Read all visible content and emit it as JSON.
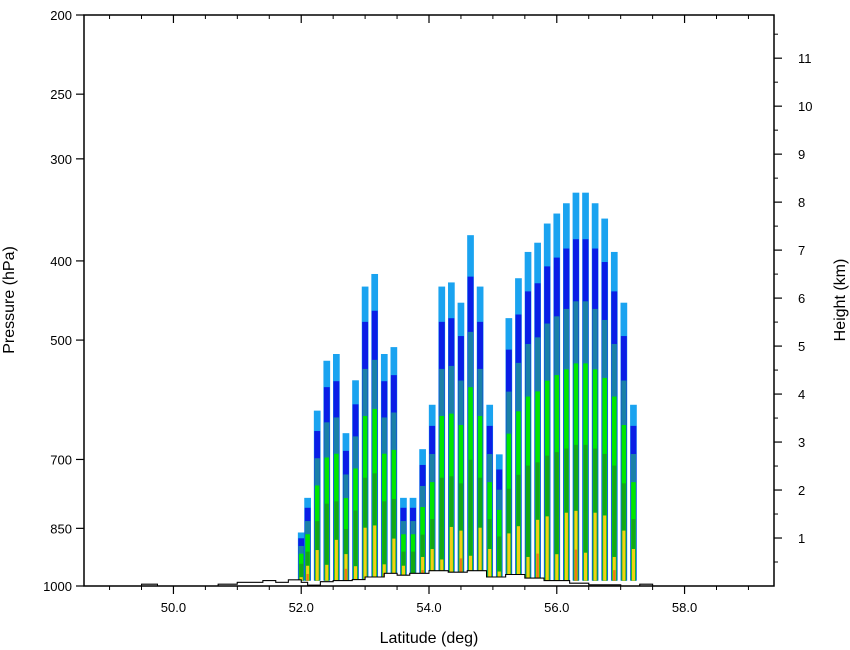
{
  "chart_data": {
    "type": "contour",
    "title": "",
    "xlabel": "Latitude (deg)",
    "ylabel": "Pressure (hPa)",
    "y2label": "Height (km)",
    "xlim": [
      48.6,
      59.4
    ],
    "ylim": [
      1000,
      200
    ],
    "yscale": "log",
    "x_ticks": [
      "50.0",
      "52.0",
      "54.0",
      "56.0",
      "58.0"
    ],
    "x_tick_values": [
      50,
      52,
      54,
      56,
      58
    ],
    "y_ticks": [
      "200",
      "250",
      "300",
      "400",
      "500",
      "700",
      "850",
      "1000"
    ],
    "y_tick_values": [
      200,
      250,
      300,
      400,
      500,
      700,
      850,
      1000
    ],
    "y2_ticks": [
      "1",
      "2",
      "3",
      "4",
      "5",
      "6",
      "7",
      "8",
      "9",
      "10",
      "11"
    ],
    "y2_tick_values": [
      1,
      2,
      3,
      4,
      5,
      6,
      7,
      8,
      9,
      10,
      11
    ],
    "level_colors": [
      "#1aa3f0",
      "#0a1ee6",
      "#1a80a8",
      "#00e600",
      "#14a814",
      "#f0d014",
      "#f07814"
    ],
    "terrain_color": "#000000",
    "grid": false,
    "legend": "none",
    "columns": [
      {
        "x": 52.0,
        "top": 860
      },
      {
        "x": 52.1,
        "top": 780
      },
      {
        "x": 52.25,
        "top": 610
      },
      {
        "x": 52.4,
        "top": 530
      },
      {
        "x": 52.55,
        "top": 520
      },
      {
        "x": 52.7,
        "top": 650
      },
      {
        "x": 52.85,
        "top": 560
      },
      {
        "x": 53.0,
        "top": 430
      },
      {
        "x": 53.15,
        "top": 415
      },
      {
        "x": 53.3,
        "top": 520
      },
      {
        "x": 53.45,
        "top": 510
      },
      {
        "x": 53.6,
        "top": 780
      },
      {
        "x": 53.75,
        "top": 780
      },
      {
        "x": 53.9,
        "top": 680
      },
      {
        "x": 54.05,
        "top": 600
      },
      {
        "x": 54.2,
        "top": 430
      },
      {
        "x": 54.35,
        "top": 425
      },
      {
        "x": 54.5,
        "top": 450
      },
      {
        "x": 54.65,
        "top": 372
      },
      {
        "x": 54.8,
        "top": 430
      },
      {
        "x": 54.95,
        "top": 600
      },
      {
        "x": 55.1,
        "top": 690
      },
      {
        "x": 55.25,
        "top": 470
      },
      {
        "x": 55.4,
        "top": 420
      },
      {
        "x": 55.55,
        "top": 390
      },
      {
        "x": 55.7,
        "top": 380
      },
      {
        "x": 55.85,
        "top": 360
      },
      {
        "x": 56.0,
        "top": 350
      },
      {
        "x": 56.15,
        "top": 340
      },
      {
        "x": 56.3,
        "top": 330
      },
      {
        "x": 56.45,
        "top": 330
      },
      {
        "x": 56.6,
        "top": 340
      },
      {
        "x": 56.75,
        "top": 355
      },
      {
        "x": 56.9,
        "top": 390
      },
      {
        "x": 57.05,
        "top": 450
      },
      {
        "x": 57.2,
        "top": 600
      }
    ],
    "terrain": [
      [
        48.6,
        1000
      ],
      [
        49.5,
        1000
      ],
      [
        49.5,
        995
      ],
      [
        49.75,
        995
      ],
      [
        49.75,
        1000
      ],
      [
        50.7,
        1000
      ],
      [
        50.7,
        995
      ],
      [
        51.0,
        995
      ],
      [
        51.0,
        990
      ],
      [
        51.4,
        990
      ],
      [
        51.4,
        985
      ],
      [
        51.6,
        985
      ],
      [
        51.6,
        990
      ],
      [
        51.8,
        990
      ],
      [
        51.8,
        983
      ],
      [
        52.0,
        983
      ],
      [
        52.0,
        990
      ],
      [
        52.1,
        990
      ],
      [
        52.1,
        998
      ],
      [
        52.3,
        998
      ],
      [
        52.3,
        988
      ],
      [
        52.5,
        988
      ],
      [
        52.5,
        985
      ],
      [
        52.8,
        985
      ],
      [
        52.8,
        982
      ],
      [
        53.0,
        982
      ],
      [
        53.0,
        975
      ],
      [
        53.3,
        975
      ],
      [
        53.3,
        965
      ],
      [
        53.5,
        965
      ],
      [
        53.5,
        970
      ],
      [
        53.7,
        970
      ],
      [
        53.7,
        965
      ],
      [
        54.0,
        965
      ],
      [
        54.0,
        958
      ],
      [
        54.3,
        958
      ],
      [
        54.3,
        962
      ],
      [
        54.6,
        962
      ],
      [
        54.6,
        958
      ],
      [
        54.9,
        958
      ],
      [
        54.9,
        975
      ],
      [
        55.2,
        975
      ],
      [
        55.2,
        968
      ],
      [
        55.5,
        968
      ],
      [
        55.5,
        978
      ],
      [
        55.8,
        978
      ],
      [
        55.8,
        985
      ],
      [
        56.2,
        985
      ],
      [
        56.2,
        992
      ],
      [
        56.5,
        992
      ],
      [
        56.5,
        997
      ],
      [
        57.0,
        997
      ],
      [
        57.0,
        1000
      ],
      [
        57.3,
        1000
      ],
      [
        57.3,
        995
      ],
      [
        57.5,
        995
      ],
      [
        57.5,
        1000
      ],
      [
        59.4,
        1000
      ]
    ]
  }
}
